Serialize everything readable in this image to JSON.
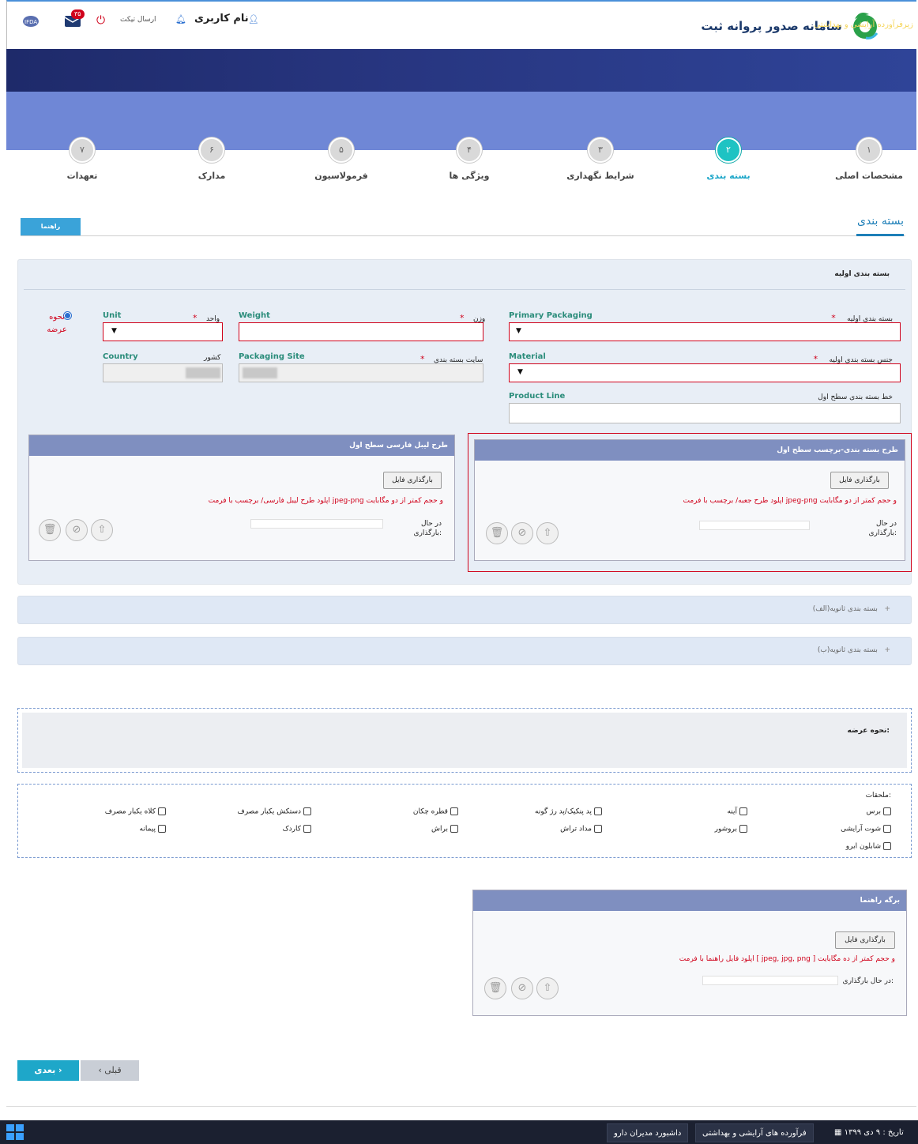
{
  "header": {
    "app_title": "سامانه صدور پروانه ثبت",
    "username": "نام کاربری",
    "send_ticket": "ارسال تیکت",
    "notification_count": "۳۵",
    "banner_subtitle": "زیرفرآورده آرایشی و بهداشتی"
  },
  "steps": [
    {
      "num": "۱",
      "label": "مشخصات اصلی",
      "active": false
    },
    {
      "num": "۲",
      "label": "بسته بندی",
      "active": true
    },
    {
      "num": "۳",
      "label": "شرایط نگهداری",
      "active": false
    },
    {
      "num": "۴",
      "label": "ویژگی ها",
      "active": false
    },
    {
      "num": "۵",
      "label": "فرمولاسیون",
      "active": false
    },
    {
      "num": "۶",
      "label": "مدارک",
      "active": false
    },
    {
      "num": "۷",
      "label": "تعهدات",
      "active": false
    }
  ],
  "page": {
    "title": "بسته بندی",
    "guide_button": "راهنما"
  },
  "primary": {
    "section_title": "بسته بندی اولیه",
    "primary_packaging_fa": "بسته بندی اولیه",
    "primary_packaging_en": "Primary Packaging",
    "weight_fa": "وزن",
    "weight_en": "Weight",
    "unit_fa": "واحد",
    "unit_en": "Unit",
    "presentation_label": "نحوه عرضه",
    "material_fa": "جنس بسته بندی اولیه",
    "material_en": "Material",
    "site_fa": "سایت بسته بندی",
    "site_en": "Packaging Site",
    "country_fa": "کشور",
    "country_en": "Country",
    "product_line_fa": "خط بسته بندی سطح اول",
    "product_line_en": "Product Line",
    "required_mark": "*"
  },
  "uploads": {
    "box_design": {
      "title": "طرح بسته بندی-برچسب سطح اول",
      "button": "بارگذاری فایل",
      "hint": "اپلود طرح جعبه/ برچسب با فرمت jpeg-png و حجم کمتر از دو مگابایت",
      "status": "در حال بارگذاری:"
    },
    "persian_label": {
      "title": "طرح لیبل فارسی سطح اول",
      "button": "بارگذاری فایل",
      "hint": "اپلود طرح لیبل فارسی/ برچسب با فرمت jpeg-png و حجم کمتر از دو مگابایت",
      "status": "در حال بارگذاری:"
    },
    "guide_sheet": {
      "title": "برگه راهنما",
      "button": "بارگذاری فایل",
      "hint": "اپلود فایل راهنما با فرمت [ jpeg, jpg, png ] و حجم کمتر از ده مگابایت",
      "status": "در حال بارگذاری:"
    }
  },
  "secondary": {
    "a": "بسته بندی ثانویه(الف)",
    "b": "بسته بندی ثانویه(ب)"
  },
  "presentation": {
    "label": "نحوه عرضه:"
  },
  "attachments": {
    "label": "ملحقات:",
    "items": [
      "برس",
      "آینه",
      "پد پنکیک/پد رژ گونه",
      "قطره چکان",
      "دستکش یکبار مصرف",
      "کلاه یکبار مصرف",
      "شوت آرایشی",
      "بروشور",
      "مداد تراش",
      "براش",
      "کاردک",
      "پیمانه",
      "شابلون ابرو"
    ]
  },
  "nav": {
    "next": "بعدی ›",
    "prev": "‹ قبلی"
  },
  "taskbar": {
    "item1": "داشبورد مدیران دارو",
    "item2": "فرآورده های آرایشی و بهداشتی",
    "date": "تاریخ : ۹ دی ۱۳۹۹"
  },
  "colors": {
    "accent": "#1ea7c9",
    "error": "#d0021b",
    "header_blue": "#6f87d6",
    "card_head": "#7f8fc0"
  }
}
